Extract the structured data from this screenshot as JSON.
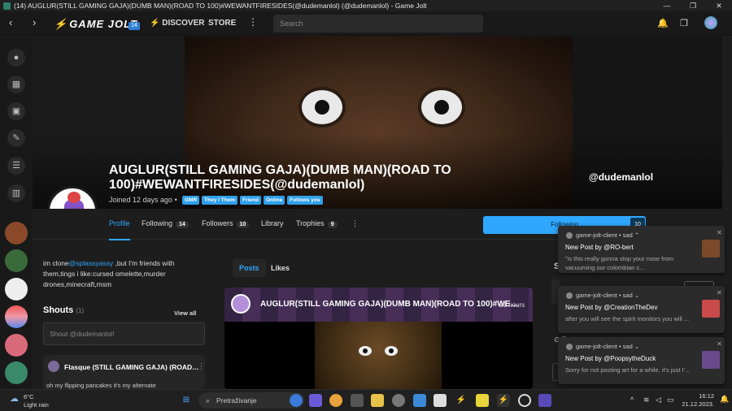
{
  "window": {
    "title": "(14) AUGLUR(STILL GAMING GAJA)(DUMB MAN)(ROAD TO 100)#WEWANTFIRESIDES(@dudemanlol) (@dudemanlol) - Game Jolt",
    "minimize": "—",
    "maximize": "❐",
    "close": "✕"
  },
  "nav": {
    "back": "‹",
    "forward": "›",
    "logo": "GAME JOLT",
    "badge": "14",
    "discover": "DISCOVER",
    "store": "STORE",
    "more": "⋮",
    "search_placeholder": "Search",
    "bell": "🔔",
    "windows": "❐"
  },
  "profile": {
    "title": "AUGLUR(STILL GAMING GAJA)(DUMB MAN)(ROAD TO 100)#WEWANTFIRESIDES(@dudemanlol)",
    "handle": "@dudemanlol",
    "joined": "Joined 12 days ago",
    "joined_dot": "•",
    "tags": [
      "GMR",
      "They / Them",
      "Friend",
      "Online",
      "Follows you"
    ]
  },
  "tabs": {
    "profile": "Profile",
    "following": "Following",
    "following_count": "14",
    "followers": "Followers",
    "followers_count": "10",
    "library": "Library",
    "trophies": "Trophies",
    "trophies_count": "9",
    "more": "⋮"
  },
  "follow": {
    "label": "Following",
    "count": "10"
  },
  "bio": {
    "pre": "im clone",
    "mention": "@splassyassy",
    "post": " ,but I'm friends with them,tings i like:cursed omelette,murder drones,minecraft,msm"
  },
  "shouts": {
    "label": "Shouts",
    "count": "(1)",
    "view_all": "View all",
    "placeholder": "Shout @dudemanlol!",
    "first_name": "Flasque (STILL GAMING GAJA) (ROAD…",
    "first_more": "⋮",
    "first_text": "oh my flipping pancakes it's my alternate"
  },
  "feed": {
    "tab_posts": "Posts",
    "tab_likes": "Likes",
    "post_title": "AUGLUR(STILL GAMING GAJA)(DUMB MAN)(ROAD TO 100)#WE…",
    "post_time": "21 hours"
  },
  "right": {
    "s_letter": "S",
    "s2": "⊙ R"
  },
  "notifications": [
    {
      "source": "game-jolt-client",
      "mood": "sad",
      "chev": "⌃",
      "title": "New Post by @RO-bert",
      "body": "\"is this really gonna stop your nose from vacuuming our colombian c...",
      "close": "✕",
      "thumb_color": "#7a4a2a"
    },
    {
      "source": "game-jolt-client",
      "mood": "sad",
      "chev": "⌄",
      "title": "New Post by @CreationTheDev",
      "body": "after you will see the spirit monitors you will ...",
      "close": "✕",
      "thumb_color": "#c84a4a"
    },
    {
      "source": "game-jolt-client",
      "mood": "sad",
      "chev": "⌄",
      "title": "New Post by @PoopsytheDuck",
      "body": "Sorry for not posting art for a while, it's just I'...",
      "close": "✕",
      "thumb_color": "#6a4a8a"
    }
  ],
  "taskbar": {
    "temp": "6°C",
    "weather": "Light rain",
    "search": "Pretraživanje",
    "time": "16:12",
    "date": "21.12.2023.",
    "chevron": "^"
  },
  "colors": {
    "accent": "#2fa7ff",
    "bg": "#1d1d1d"
  }
}
